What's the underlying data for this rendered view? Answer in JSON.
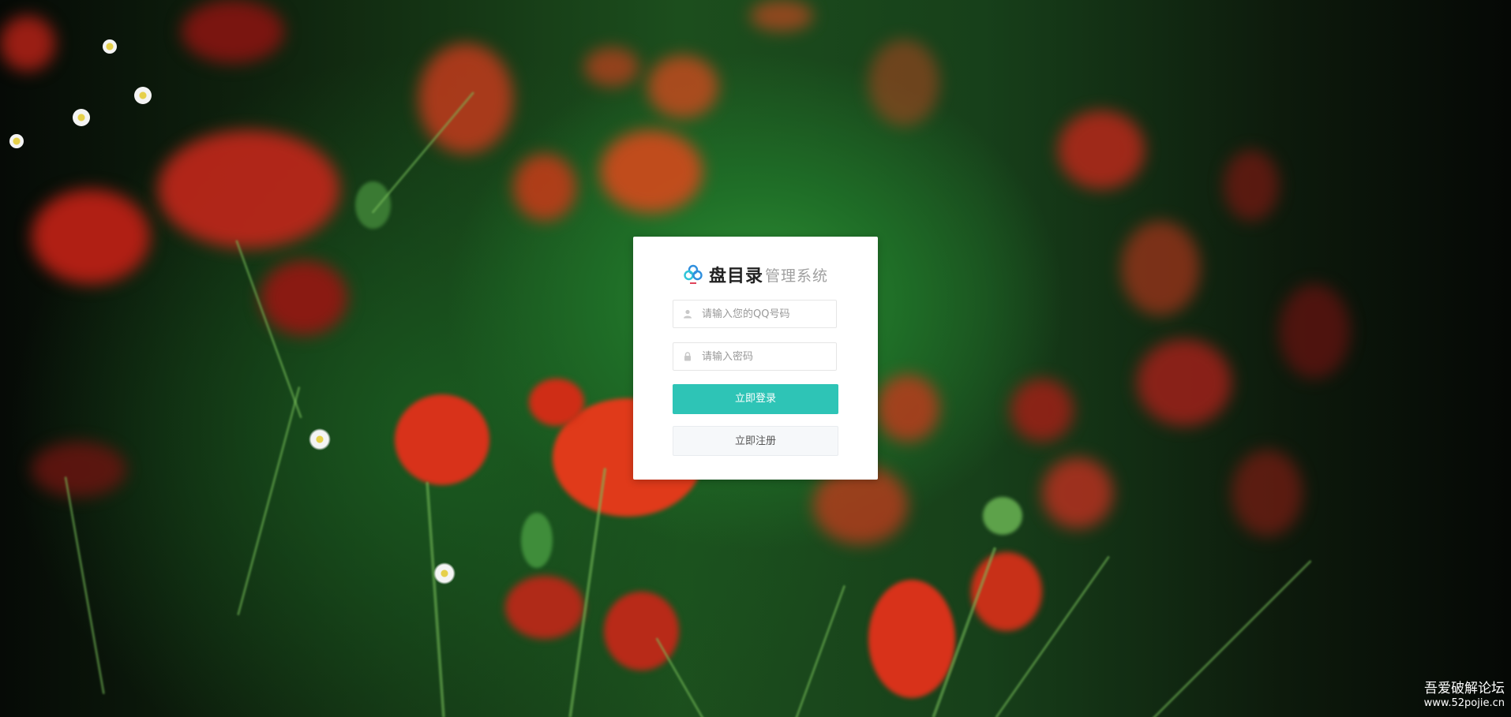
{
  "login": {
    "brand_name": "盘目录",
    "brand_subtitle": "管理系统",
    "qq_placeholder": "请输入您的QQ号码",
    "qq_value": "",
    "password_placeholder": "请输入密码",
    "password_value": "",
    "login_button": "立即登录",
    "register_button": "立即注册"
  },
  "icons": {
    "logo": "cloud-logo-icon",
    "qq_field": "user-icon",
    "password_field": "lock-icon"
  },
  "colors": {
    "primary": "#2ec4b6",
    "card_background": "#ffffff",
    "logo_blue": "#2f8fde",
    "logo_red": "#e0445a"
  },
  "watermark": {
    "title": "吾爱破解论坛",
    "url": "www.52pojie.cn"
  }
}
